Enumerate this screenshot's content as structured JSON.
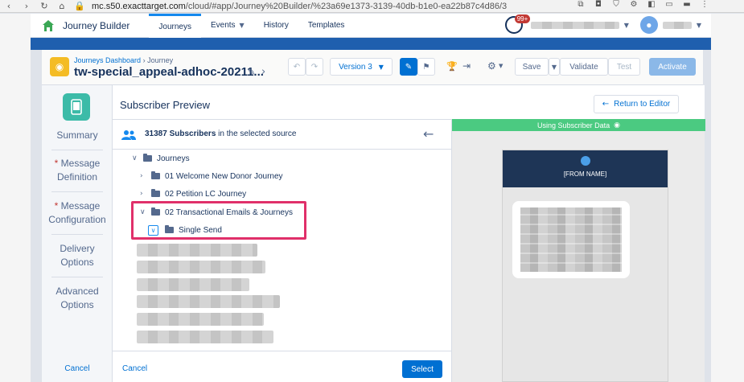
{
  "browser": {
    "url_host": "mc.s50.exacttarget.com",
    "url_path": "/cloud/#app/Journey%20Builder/%23a69e1373-3139-40db-b1e0-ea22b87c4d86/3"
  },
  "app_header": {
    "app_name": "Journey Builder",
    "tabs": [
      {
        "label": "Journeys",
        "active": true
      },
      {
        "label": "Events",
        "active": false,
        "dropdown": true
      },
      {
        "label": "History",
        "active": false
      },
      {
        "label": "Templates",
        "active": false
      }
    ],
    "notification_badge": "99+"
  },
  "journey": {
    "breadcrumb_dashboard": "Journeys Dashboard",
    "breadcrumb_separator": "›",
    "breadcrumb_current": "Journey",
    "name": "tw-special_appeal-adhoc-20211...",
    "version": "Version 3",
    "save_label": "Save",
    "validate_label": "Validate",
    "test_label": "Test",
    "activate_label": "Activate"
  },
  "steps": {
    "summary": "Summary",
    "message_definition": [
      "Message",
      "Definition"
    ],
    "message_configuration": [
      "Message",
      "Configuration"
    ],
    "delivery_options": [
      "Delivery",
      "Options"
    ],
    "advanced_options": [
      "Advanced",
      "Options"
    ],
    "cancel": "Cancel"
  },
  "preview": {
    "title": "Subscriber Preview",
    "return_label": "Return to Editor",
    "subscriber_count": "31387 Subscribers",
    "source_text": " in the selected source",
    "tree": {
      "root": "Journeys",
      "items": [
        "01 Welcome New Donor Journey",
        "02 Petition LC Journey",
        "02 Transactional Emails & Journeys"
      ],
      "selected_child": "Single Send"
    },
    "cancel_label": "Cancel",
    "select_label": "Select",
    "data_banner": "Using Subscriber Data",
    "from_name": "[FROM NAME]"
  },
  "colors": {
    "accent": "#0070d2",
    "highlight": "#e0306a",
    "banner": "#4bca81",
    "phone_header": "#1e3556"
  }
}
